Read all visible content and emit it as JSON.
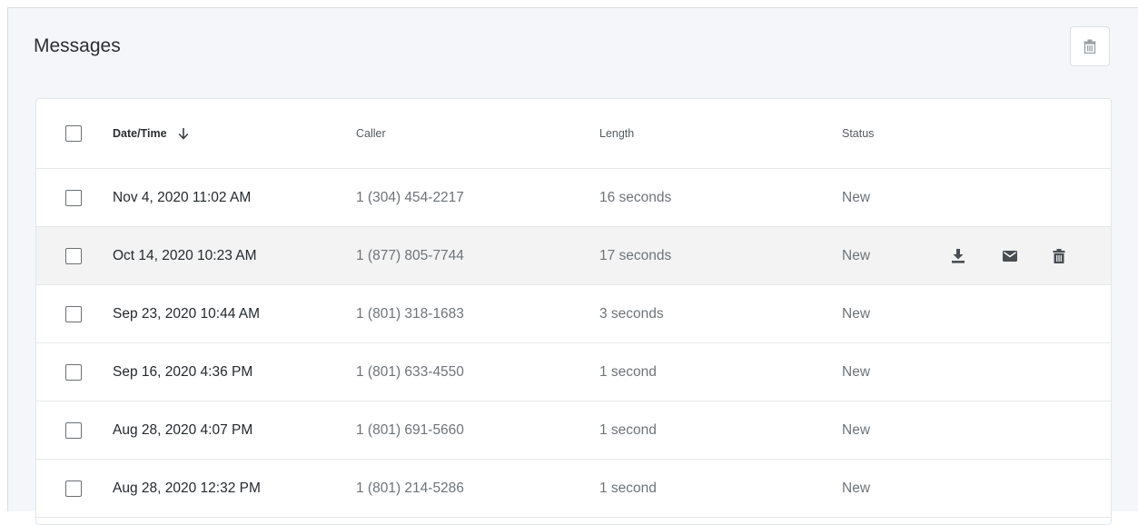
{
  "header": {
    "title": "Messages"
  },
  "table": {
    "columns": {
      "date": "Date/Time",
      "caller": "Caller",
      "length": "Length",
      "status": "Status"
    },
    "rows": [
      {
        "date": "Nov 4, 2020 11:02 AM",
        "caller": "1 (304) 454-2217",
        "length": "16 seconds",
        "status": "New"
      },
      {
        "date": "Oct 14, 2020 10:23 AM",
        "caller": "1 (877) 805-7744",
        "length": "17 seconds",
        "status": "New"
      },
      {
        "date": "Sep 23, 2020 10:44 AM",
        "caller": "1 (801) 318-1683",
        "length": "3 seconds",
        "status": "New"
      },
      {
        "date": "Sep 16, 2020 4:36 PM",
        "caller": "1 (801) 633-4550",
        "length": "1 second",
        "status": "New"
      },
      {
        "date": "Aug 28, 2020 4:07 PM",
        "caller": "1 (801) 691-5660",
        "length": "1 second",
        "status": "New"
      },
      {
        "date": "Aug 28, 2020 12:32 PM",
        "caller": "1 (801) 214-5286",
        "length": "1 second",
        "status": "New"
      }
    ]
  },
  "icons": {
    "delete_all": "trash-icon",
    "sort": "arrow-down-icon",
    "row_actions": [
      "download-icon",
      "email-icon",
      "trash-icon"
    ]
  }
}
